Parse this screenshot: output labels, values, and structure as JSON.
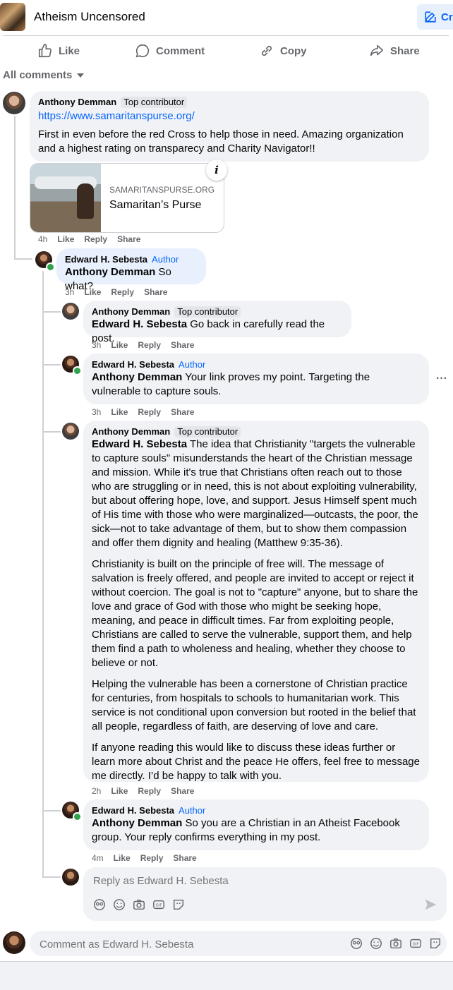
{
  "header": {
    "group_name": "Atheism Uncensored",
    "create_label": "Cre"
  },
  "actions": {
    "like": "Like",
    "comment": "Comment",
    "copy": "Copy",
    "share": "Share"
  },
  "filter": {
    "label": "All comments"
  },
  "comments": [
    {
      "author": "Anthony Demman",
      "badge": "Top contributor",
      "link": "https://www.samaritanspurse.org/",
      "text": "First in even before the red Cross to help those in need. Amazing organization and a highest rating on transparecy and Charity Navigator!!",
      "preview": {
        "domain": "SAMARITANSPURSE.ORG",
        "title": "Samaritan’s Purse",
        "info": "i"
      },
      "time": "4h",
      "like": "Like",
      "reply": "Reply",
      "share": "Share"
    },
    {
      "author": "Edward H. Sebesta",
      "badge": "Author",
      "mention": "Anthony Demman",
      "text": " So what?",
      "time": "3h",
      "like": "Like",
      "reply": "Reply",
      "share": "Share"
    },
    {
      "author": "Anthony Demman",
      "badge": "Top contributor",
      "mention": "Edward H. Sebesta",
      "text": " Go back in carefully read the post.",
      "time": "3h",
      "like": "Like",
      "reply": "Reply",
      "share": "Share"
    },
    {
      "author": "Edward H. Sebesta",
      "badge": "Author",
      "mention": "Anthony Demman",
      "text": " Your link proves my point. Targeting the vulnerable to capture souls.",
      "time": "3h",
      "like": "Like",
      "reply": "Reply",
      "share": "Share",
      "more": "···"
    },
    {
      "author": "Anthony Demman",
      "badge": "Top contributor",
      "mention": "Edward H. Sebesta",
      "p1": " The idea that Christianity \"targets the vulnerable to capture souls\" misunderstands the heart of the Christian message and mission. While it's true that Christians often reach out to those who are struggling or in need, this is not about exploiting vulnerability, but about offering hope, love, and support. Jesus Himself spent much of His time with those who were marginalized—outcasts, the poor, the sick—not to take advantage of them, but to show them compassion and offer them dignity and healing (Matthew 9:35-36).",
      "p2": "Christianity is built on the principle of free will. The message of salvation is freely offered, and people are invited to accept or reject it without coercion. The goal is not to \"capture\" anyone, but to share the love and grace of God with those who might be seeking hope, meaning, and peace in difficult times. Far from exploiting people, Christians are called to serve the vulnerable, support them, and help them find a path to wholeness and healing, whether they choose to believe or not.",
      "p3": "Helping the vulnerable has been a cornerstone of Christian practice for centuries, from hospitals to schools to humanitarian work. This service is not conditional upon conversion but rooted in the belief that all people, regardless of faith, are deserving of love and care.",
      "p4": "If anyone reading this would like to discuss these ideas further or learn more about Christ and the peace He offers, feel free to message me directly. I’d be happy to talk with you.",
      "time": "2h",
      "like": "Like",
      "reply": "Reply",
      "share": "Share"
    },
    {
      "author": "Edward H. Sebesta",
      "badge": "Author",
      "mention": "Anthony Demman",
      "text": " So you are a Christian in an Atheist Facebook group. Your reply confirms everything in my post.",
      "time": "4m",
      "like": "Like",
      "reply": "Reply",
      "share": "Share"
    }
  ],
  "reply_box": {
    "placeholder": "Reply as Edward H. Sebesta"
  },
  "comment_box": {
    "placeholder": "Comment as Edward H. Sebesta"
  },
  "colors": {
    "accent": "#0866ff",
    "bubble": "#f0f2f5",
    "muted": "#65676b",
    "online": "#31a24c"
  },
  "icon_names": [
    "like-icon",
    "comment-icon",
    "copy-icon",
    "share-icon",
    "chevron-down-icon",
    "info-icon",
    "avatar-icon",
    "emoji-icon",
    "camera-icon",
    "gif-icon",
    "sticker-icon",
    "send-icon",
    "more-icon",
    "edit-icon"
  ]
}
